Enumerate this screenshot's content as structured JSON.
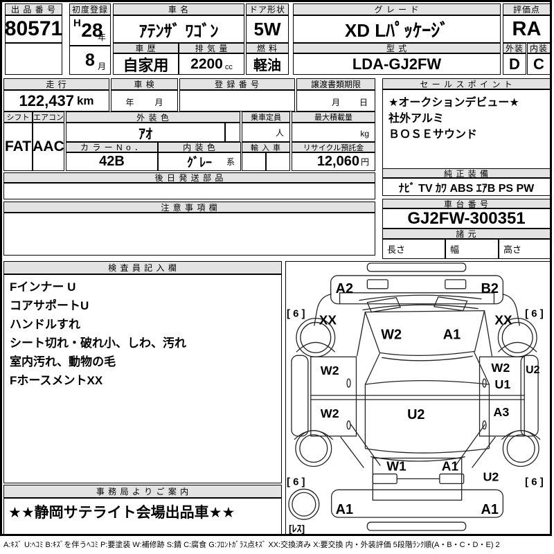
{
  "top": {
    "auction_no": {
      "label": "出 品 番 号",
      "value": "80571"
    },
    "first_reg": {
      "label": "初度登録",
      "era": "H",
      "year": "28",
      "year_unit": "年",
      "month": "8",
      "month_unit": "月"
    },
    "car_name": {
      "label": "車 名",
      "value": "ｱﾃﾝｻﾞ ﾜｺﾞﾝ"
    },
    "door": {
      "label": "ドア形状",
      "value": "5W"
    },
    "grade": {
      "label": "グ レ ー ド",
      "value": "XD Lﾊﾟｯｹｰｼﾞ"
    },
    "score": {
      "label": "評価点",
      "value": "RA"
    },
    "history": {
      "label": "車 歴",
      "value": "自家用"
    },
    "displacement": {
      "label": "排 気 量",
      "value": "2200",
      "unit": "cc"
    },
    "fuel": {
      "label": "燃 料",
      "value": "軽油"
    },
    "model": {
      "label": "型 式",
      "value": "LDA-GJ2FW"
    },
    "exterior": {
      "label": "外装",
      "value": "D"
    },
    "interior": {
      "label": "内装",
      "value": "C"
    }
  },
  "run": {
    "mileage": {
      "label": "走 行",
      "value": "122,437",
      "unit": "km"
    },
    "inspection": {
      "label": "車 検",
      "unit1": "年",
      "unit2": "月"
    },
    "reg_no": {
      "label": "登 録 番 号",
      "value": ""
    },
    "deadline": {
      "label": "譲渡書類期限",
      "unit1": "月",
      "unit2": "日"
    },
    "shift": {
      "label": "シフト",
      "value": "FAT"
    },
    "aircon": {
      "label": "エアコン",
      "value": "AAC"
    },
    "ext_color": {
      "label": "外 装 色",
      "value": "ｱｵ"
    },
    "capacity": {
      "label": "乗車定員",
      "unit": "人"
    },
    "max_load": {
      "label": "最大積載量",
      "unit": "kg"
    },
    "color_no": {
      "label": "カ ラ ー N o ．",
      "value": "42B"
    },
    "int_color": {
      "label": "内 装 色",
      "value": "ｸﾞﾚｰ",
      "suffix": "系"
    },
    "import_car": {
      "label": "輸 入 車"
    },
    "recycle": {
      "label": "リサイクル預託金",
      "value": "12,060",
      "unit": "円"
    }
  },
  "later_parts": {
    "label": "後 日 発 送 部 品",
    "value": ""
  },
  "caution": {
    "label": "注 意 事 項 欄",
    "value": ""
  },
  "sales": {
    "label": "セ ー ル ス ポ イ ン ト",
    "lines": [
      "★オークションデビュー★",
      "社外アルミ",
      "ＢＯＳＥサウンド"
    ]
  },
  "equipment": {
    "label": "純 正 装 備",
    "value": "ﾅﾋﾞ TV ｶﾜ ABS ｴｱB PS PW"
  },
  "chassis": {
    "label": "車 台 番 号",
    "value": "GJ2FW-300351"
  },
  "specs": {
    "label": "諸 元",
    "length": "長さ",
    "width": "幅",
    "height": "高さ"
  },
  "inspector": {
    "label": "検 査 員 記 入 欄",
    "lines": [
      "Fインナー U",
      "コアサポートU",
      "ハンドルすれ",
      "シート切れ・破れ小、しわ、汚れ",
      "室内汚れ、動物の毛",
      "FホースメントXX"
    ]
  },
  "office": {
    "label": "事 務 局 よ り ご 案 内",
    "value": "★★静岡サテライト会場出品車★★"
  },
  "legend": {
    "text": "A:ｷｽﾞ U:ﾍｺﾐ B:ｷｽﾞを伴うﾍｺﾐ P:要塗装 W:補修跡 S:錆 C:腐食 G:ﾌﾛﾝﾄｶﾞﾗｽ点ｷｽﾞ XX:交換済み X:要交換  内・外装評価 5段階ﾗﾝｸ順(A・B・C・D・E) 2"
  },
  "diagram": {
    "front_bumper_left": "A2",
    "front_bumper_right": "B2",
    "fender_left": "XX",
    "fender_right": "XX",
    "tire_front_left": "[ 6 ]",
    "tire_front_right": "[ 6 ]",
    "hood_left": "W2",
    "hood_right": "A1",
    "door_front_left": "W2",
    "door_rear_left": "W2",
    "door_front_right": "W2",
    "door_front_right_sub": "U1",
    "door_rear_right": "A3",
    "side_right": "U2",
    "roof": "U2",
    "tailgate_left": "W1",
    "tailgate_right": "A1",
    "quarter_right": "U2",
    "tire_rear_left": "[ 6 ]",
    "tire_rear_right": "[ 6 ]",
    "rear_bumper_left": "A1",
    "rear_bumper_right": "A1",
    "spare": "[ﾚｽ]"
  }
}
